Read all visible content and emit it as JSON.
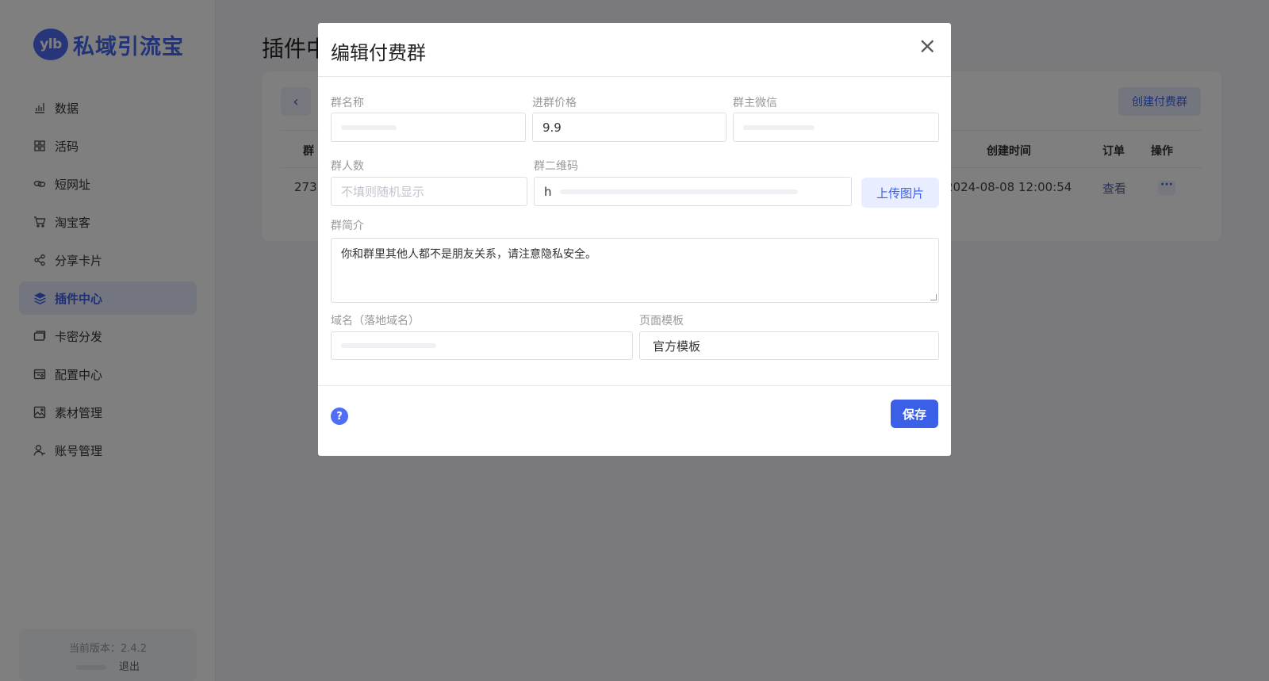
{
  "brand": {
    "badge": "ylb",
    "name": "私域引流宝"
  },
  "sidebar": {
    "items": [
      {
        "label": "数据",
        "icon": "bar-chart-icon",
        "active": false
      },
      {
        "label": "活码",
        "icon": "grid-icon",
        "active": false
      },
      {
        "label": "短网址",
        "icon": "link-icon",
        "active": false
      },
      {
        "label": "淘宝客",
        "icon": "cart-icon",
        "active": false
      },
      {
        "label": "分享卡片",
        "icon": "share-icon",
        "active": false
      },
      {
        "label": "插件中心",
        "icon": "layers-icon",
        "active": true
      },
      {
        "label": "卡密分发",
        "icon": "card-icon",
        "active": false
      },
      {
        "label": "配置中心",
        "icon": "settings-panel-icon",
        "active": false
      },
      {
        "label": "素材管理",
        "icon": "image-icon",
        "active": false
      },
      {
        "label": "账号管理",
        "icon": "user-icon",
        "active": false
      }
    ],
    "version_label": "当前版本：2.4.2",
    "logout_label": "退出"
  },
  "main": {
    "page_title": "插件中",
    "create_button": "创建付费群",
    "table": {
      "headers": {
        "first": "群",
        "created": "创建时间",
        "orders": "订单",
        "actions": "操作"
      },
      "rows": [
        {
          "id": "273",
          "created": "2024-08-08 12:00:54",
          "orders": "查看",
          "more": "···"
        }
      ]
    }
  },
  "modal": {
    "title": "编辑付费群",
    "close": "×",
    "fields": {
      "group_name": {
        "label": "群名称",
        "value": ""
      },
      "price": {
        "label": "进群价格",
        "value": "9.9"
      },
      "owner_wechat": {
        "label": "群主微信",
        "value": ""
      },
      "member_count": {
        "label": "群人数",
        "placeholder": "不填则随机显示"
      },
      "qr_code": {
        "label": "群二维码",
        "value": "h"
      },
      "description": {
        "label": "群简介",
        "value": "你和群里其他人都不是朋友关系，请注意隐私安全。"
      },
      "domain": {
        "label": "域名（落地域名）",
        "value": ""
      },
      "template": {
        "label": "页面模板",
        "value": "官方模板"
      }
    },
    "upload_button": "上传图片",
    "help_icon": "?",
    "save_button": "保存"
  },
  "colors": {
    "accent": "#3c5fe8",
    "accent_light": "#e8edff",
    "overlay": "rgba(0,0,0,0.5)"
  }
}
